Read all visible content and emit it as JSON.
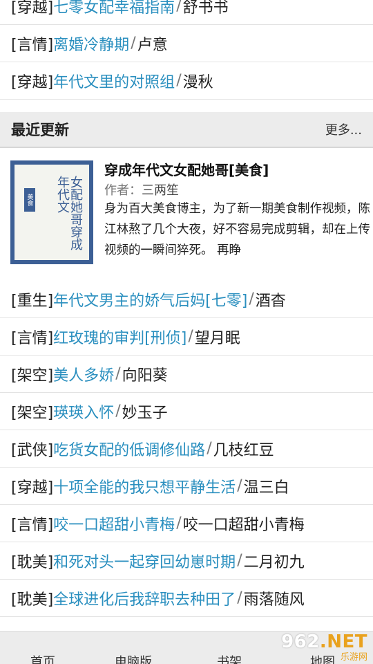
{
  "top_list": [
    {
      "cat": "[穿越]",
      "title": "七零女配幸福指南",
      "author": "舒书书"
    },
    {
      "cat": "[言情]",
      "title": "离婚冷静期",
      "author": "卢意"
    },
    {
      "cat": "[穿越]",
      "title": "年代文里的对照组",
      "author": "漫秋"
    }
  ],
  "section": {
    "title": "最近更新",
    "more": "更多..."
  },
  "featured": {
    "title": "穿成年代文女配她哥[美食]",
    "author_label": "作者：",
    "author": "三两笙",
    "desc": "身为百大美食博主，为了新一期美食制作视频，陈江林熬了几个大夜，好不容易完成剪辑，却在上传视频的一瞬间猝死。 再睁",
    "cover_text": "女配她哥穿成年代文",
    "cover_badge": "美食"
  },
  "bottom_list": [
    {
      "cat": "[重生]",
      "title": "年代文男主的娇气后妈[七零]",
      "author": "酒杳"
    },
    {
      "cat": "[言情]",
      "title": "红玫瑰的审判[刑侦]",
      "author": "望月眠"
    },
    {
      "cat": "[架空]",
      "title": "美人多娇",
      "author": "向阳葵"
    },
    {
      "cat": "[架空]",
      "title": "瑛瑛入怀",
      "author": "妙玉子"
    },
    {
      "cat": "[武侠]",
      "title": "吃货女配的低调修仙路",
      "author": "几枝红豆"
    },
    {
      "cat": "[穿越]",
      "title": "十项全能的我只想平静生活",
      "author": "温三白"
    },
    {
      "cat": "[言情]",
      "title": "咬一口超甜小青梅",
      "author": "咬一口超甜小青梅"
    },
    {
      "cat": "[耽美]",
      "title": "和死对头一起穿回幼崽时期",
      "author": "二月初九"
    },
    {
      "cat": "[耽美]",
      "title": "全球进化后我辞职去种田了",
      "author": "雨落随风"
    }
  ],
  "sep": "/",
  "footer": {
    "nav": [
      "首页",
      "电脑版",
      "书架",
      "地图"
    ]
  },
  "watermark": {
    "main_a": "9",
    "main_b": "62",
    "main_c": ".NET",
    "sub": "乐游网"
  },
  "colors": {
    "link": "#2a8fbf",
    "cover": "#3c5f95",
    "header_bg": "#ececec"
  }
}
